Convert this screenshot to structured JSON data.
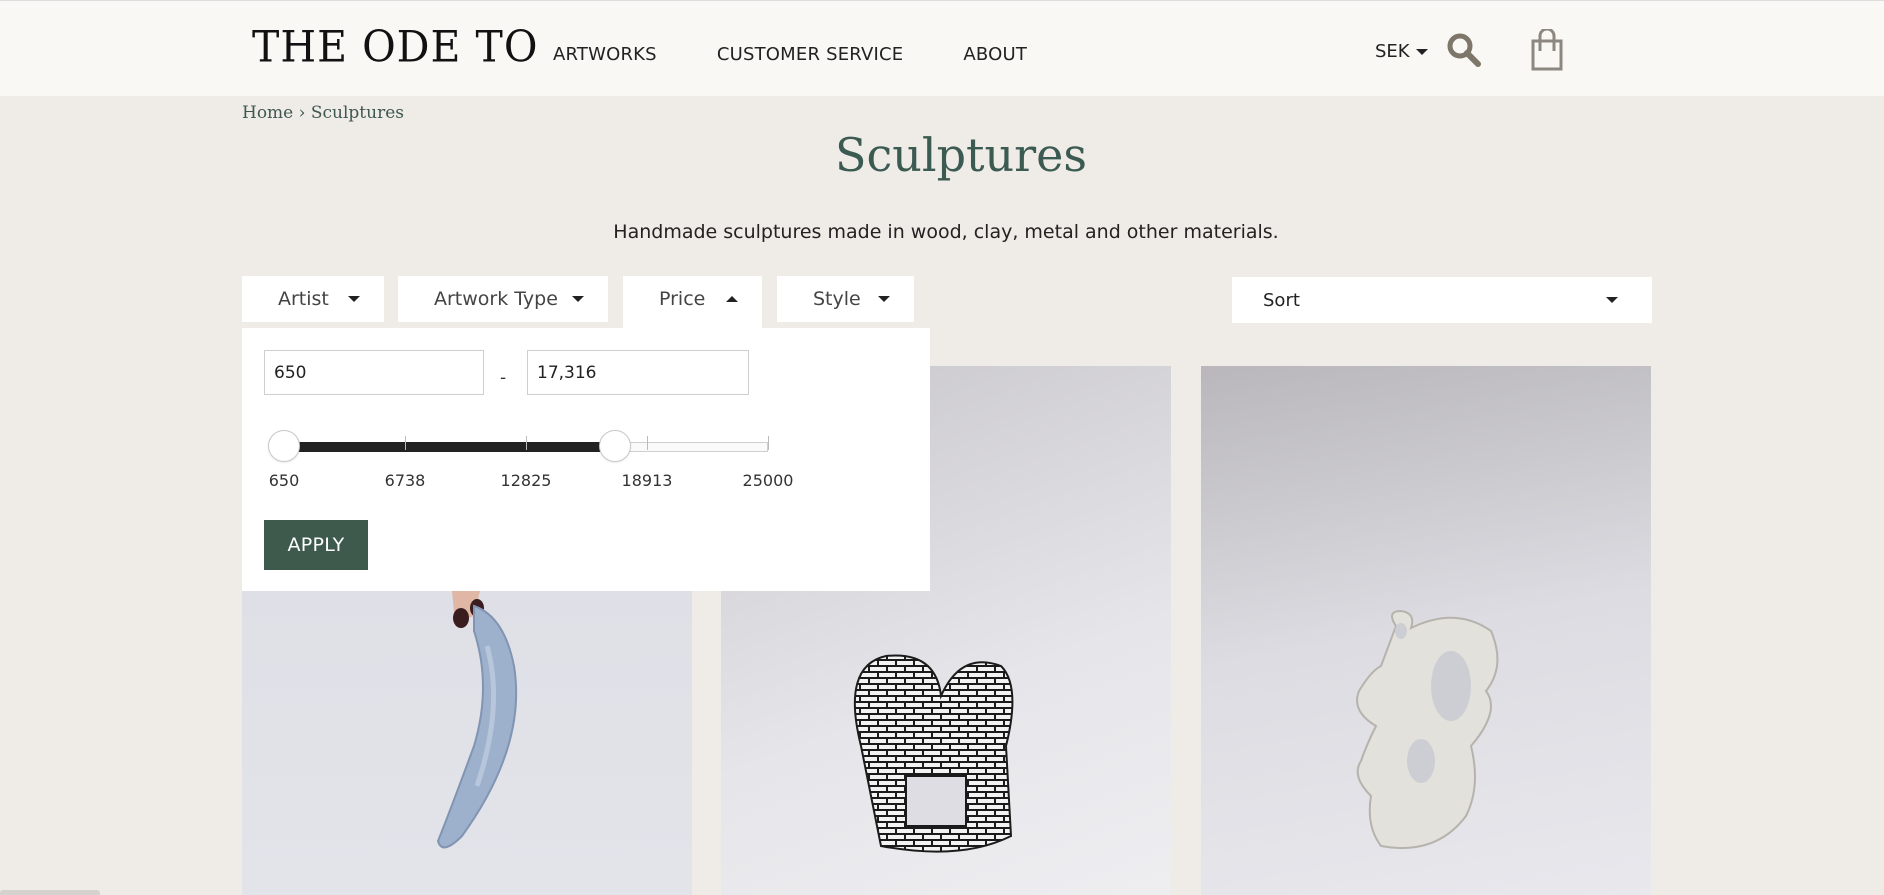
{
  "header": {
    "logo": "THE ODE TO",
    "nav": [
      "ARTWORKS",
      "CUSTOMER SERVICE",
      "ABOUT"
    ],
    "currency": "SEK"
  },
  "breadcrumb": {
    "home": "Home",
    "separator": "›",
    "current": "Sculptures"
  },
  "page": {
    "title": "Sculptures",
    "description": "Handmade sculptures made in wood, clay, metal and other materials."
  },
  "filters": {
    "artist": "Artist",
    "artwork_type": "Artwork Type",
    "price": "Price",
    "style": "Style",
    "sort": "Sort"
  },
  "price_filter": {
    "min_value": "650",
    "max_value": "17,316",
    "dash": "-",
    "slider_min": 650,
    "slider_max": 25000,
    "selected_min": 650,
    "selected_max": 17316,
    "tick_labels": [
      "650",
      "6738",
      "12825",
      "18913",
      "25000"
    ],
    "apply_label": "APPLY"
  },
  "products": [
    {
      "icon": "banana-sculpture-image"
    },
    {
      "icon": "knot-sculpture-image"
    },
    {
      "icon": "abstract-sculpture-image"
    }
  ],
  "colors": {
    "accent": "#3d5a4c",
    "title": "#3b5a52",
    "page_bg": "#efebe7",
    "header_bg": "#f9f8f5"
  }
}
